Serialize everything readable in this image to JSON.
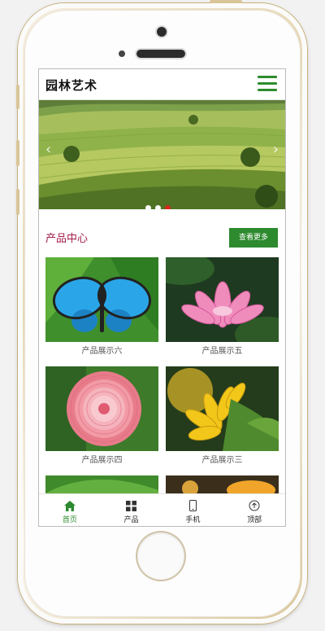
{
  "header": {
    "logo_text": "园林艺术"
  },
  "banner": {
    "prev_glyph": "‹",
    "next_glyph": "›",
    "slide_count": 3,
    "active_slide": 3
  },
  "section": {
    "title": "产品中心",
    "more_label": "查看更多"
  },
  "products": [
    {
      "label": "产品展示六",
      "image": "blue-butterfly"
    },
    {
      "label": "产品展示五",
      "image": "pink-lotus"
    },
    {
      "label": "产品展示四",
      "image": "pink-dahlia"
    },
    {
      "label": "产品展示三",
      "image": "sunflower"
    },
    {
      "label": "",
      "image": "green-leaf-partial"
    },
    {
      "label": "",
      "image": "flower-partial"
    }
  ],
  "bottom_nav": [
    {
      "label": "首页",
      "icon": "home-icon",
      "active": true
    },
    {
      "label": "产品",
      "icon": "grid-icon",
      "active": false
    },
    {
      "label": "手机",
      "icon": "phone-icon",
      "active": false
    },
    {
      "label": "顶部",
      "icon": "arrow-up-icon",
      "active": false
    }
  ],
  "colors": {
    "accent": "#2d8a2e",
    "section_title": "#a31c4c",
    "active_dot": "#d8261c"
  }
}
